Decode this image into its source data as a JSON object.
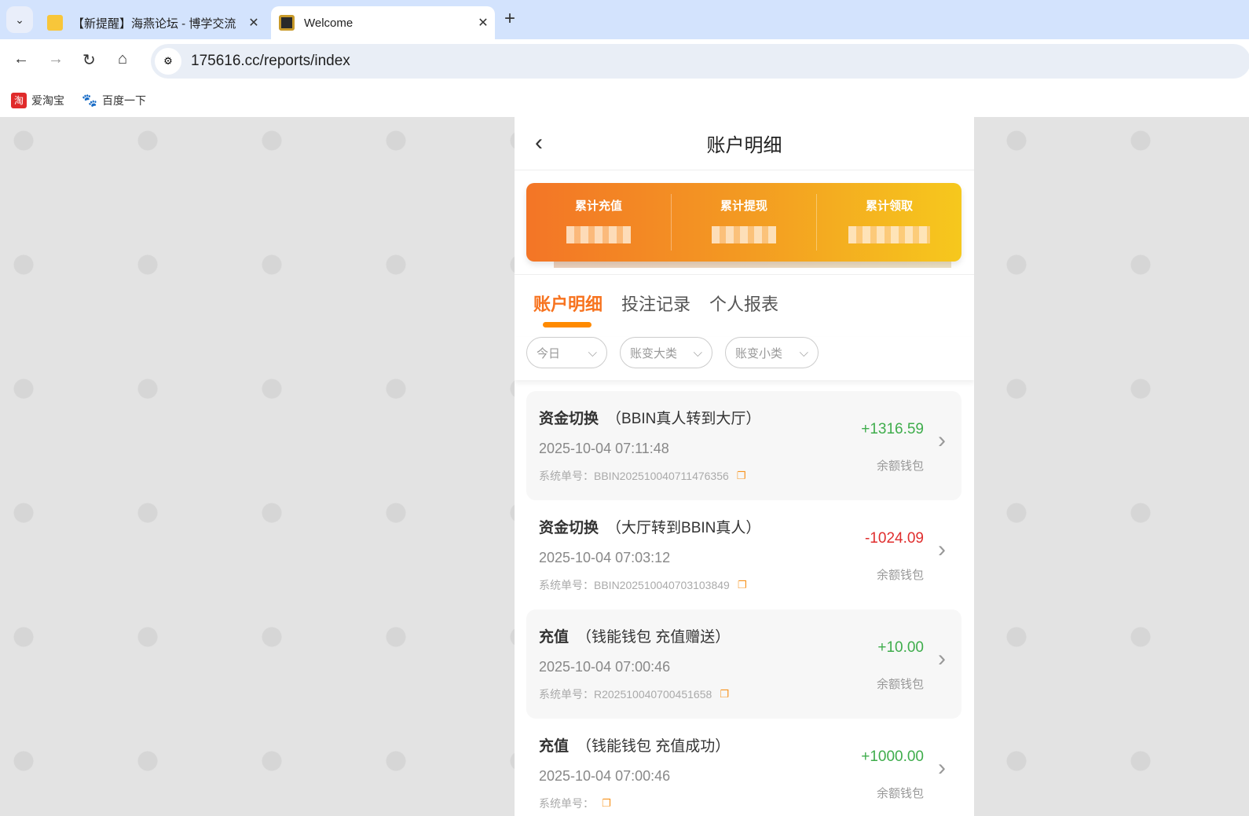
{
  "browser": {
    "tabs": [
      {
        "title": "【新提醒】海燕论坛 - 博学交流",
        "active": false
      },
      {
        "title": "Welcome",
        "active": true
      }
    ],
    "url": "175616.cc/reports/index",
    "bookmarks": [
      {
        "label": "爱淘宝",
        "icon": "taobao-icon",
        "icon_text": "淘"
      },
      {
        "label": "百度一下",
        "icon": "baidu-paw-icon"
      }
    ]
  },
  "page": {
    "title": "账户明细",
    "summary": [
      {
        "label": "累计充值"
      },
      {
        "label": "累计提现"
      },
      {
        "label": "累计领取"
      }
    ],
    "tabs": [
      {
        "label": "账户明细",
        "active": true
      },
      {
        "label": "投注记录"
      },
      {
        "label": "个人报表"
      }
    ],
    "filters": [
      {
        "label": "今日"
      },
      {
        "label": "账变大类"
      },
      {
        "label": "账变小类"
      }
    ],
    "records": [
      {
        "type": "资金切换",
        "detail": "（BBIN真人转到大厅）",
        "time": "2025-10-04 07:11:48",
        "order_label": "系统单号：",
        "order_no": "BBIN202510040711476356",
        "amount": "+1316.59",
        "wallet": "余额钱包",
        "sign": "pos"
      },
      {
        "type": "资金切换",
        "detail": "（大厅转到BBIN真人）",
        "time": "2025-10-04 07:03:12",
        "order_label": "系统单号：",
        "order_no": "BBIN202510040703103849",
        "amount": "-1024.09",
        "wallet": "余额钱包",
        "sign": "neg"
      },
      {
        "type": "充值",
        "detail": "（钱能钱包 充值赠送）",
        "time": "2025-10-04 07:00:46",
        "order_label": "系统单号：",
        "order_no": "R202510040700451658",
        "amount": "+10.00",
        "wallet": "余额钱包",
        "sign": "pos"
      },
      {
        "type": "充值",
        "detail": "（钱能钱包 充值成功）",
        "time": "2025-10-04 07:00:46",
        "order_label": "系统单号：",
        "order_no": "",
        "amount": "+1000.00",
        "wallet": "余额钱包",
        "sign": "pos"
      }
    ],
    "colors": {
      "accent": "#f7731f",
      "positive": "#3fad4c",
      "negative": "#e02e2e"
    }
  }
}
